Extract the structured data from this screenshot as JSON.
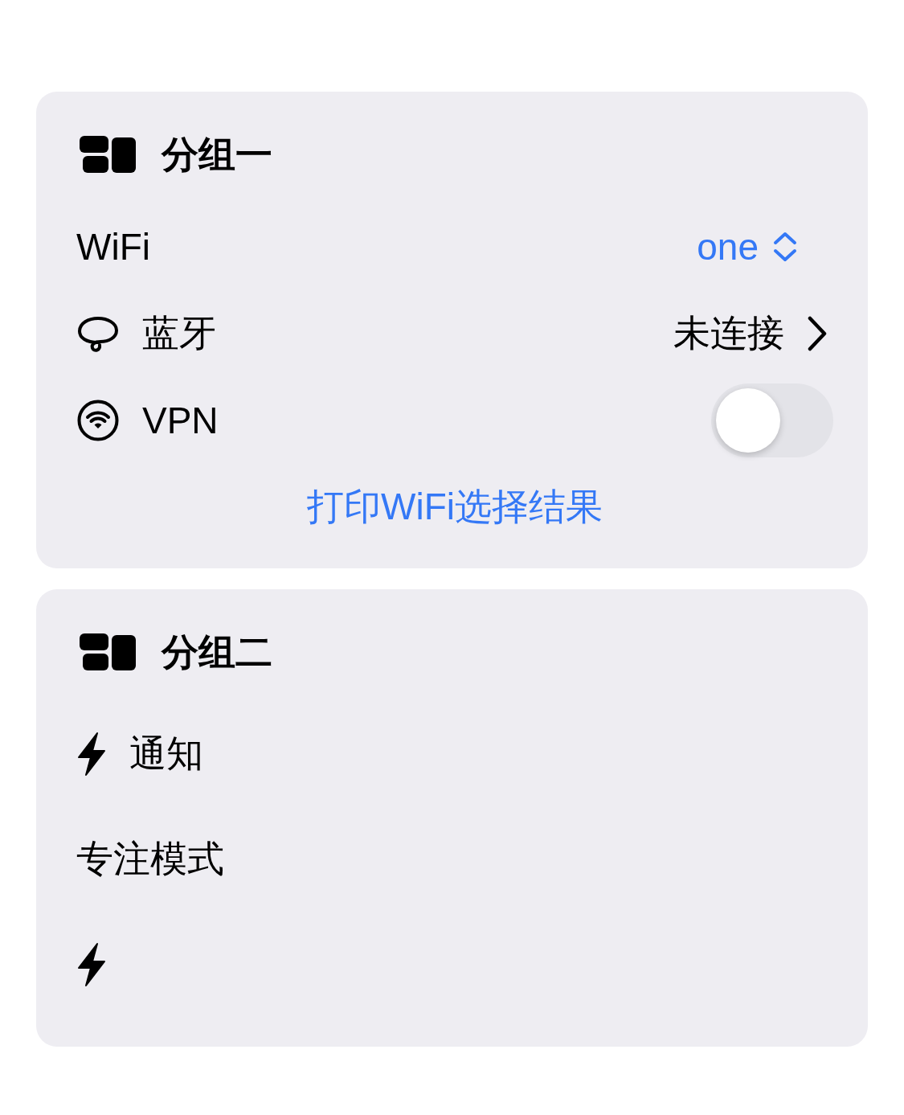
{
  "groups": [
    {
      "title": "分组一",
      "rows": [
        {
          "kind": "picker",
          "label": "WiFi",
          "value": "one"
        },
        {
          "kind": "link",
          "label": "蓝牙",
          "value": "未连接"
        },
        {
          "kind": "toggle",
          "label": "VPN",
          "on": false
        }
      ],
      "action": "打印WiFi选择结果"
    },
    {
      "title": "分组二",
      "rows": [
        {
          "kind": "label",
          "label": "通知"
        },
        {
          "kind": "plain",
          "label": "专注模式"
        },
        {
          "kind": "icon"
        }
      ]
    }
  ]
}
